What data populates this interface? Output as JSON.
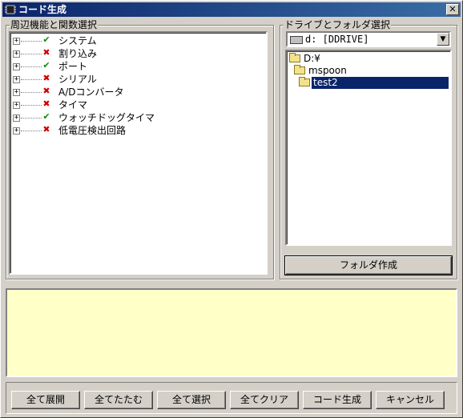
{
  "window": {
    "title": "コード生成",
    "close_glyph": "✕"
  },
  "peripherals": {
    "legend": "周辺機能と関数選択",
    "items": [
      {
        "label": "システム",
        "state": "ok",
        "expander": "+"
      },
      {
        "label": "割り込み",
        "state": "ng",
        "expander": "+"
      },
      {
        "label": "ポート",
        "state": "ok",
        "expander": "+"
      },
      {
        "label": "シリアル",
        "state": "ng",
        "expander": "+"
      },
      {
        "label": "A/Dコンバータ",
        "state": "ng",
        "expander": "+"
      },
      {
        "label": "タイマ",
        "state": "ng",
        "expander": "+"
      },
      {
        "label": "ウォッチドッグタイマ",
        "state": "ok",
        "expander": "+"
      },
      {
        "label": "低電圧検出回路",
        "state": "ng",
        "expander": "+"
      }
    ],
    "state_glyphs": {
      "ok": "✔",
      "ng": "✖"
    }
  },
  "drive_folder": {
    "legend": "ドライブとフォルダ選択",
    "drive": "d: [DDRIVE]",
    "dropdown_glyph": "▼",
    "folders": [
      {
        "label": "D:¥",
        "selected": false
      },
      {
        "label": "mspoon",
        "selected": false
      },
      {
        "label": "test2",
        "selected": true
      }
    ],
    "make_folder_button": "フォルダ作成"
  },
  "message": "",
  "footer_buttons": {
    "expand_all": "全て展開",
    "collapse_all": "全てたたむ",
    "select_all": "全て選択",
    "clear_all": "全てクリア",
    "generate": "コード生成",
    "cancel": "キャンセル"
  },
  "colors": {
    "title_start": "#0a246a",
    "title_end": "#3a6ea5",
    "selection": "#0a246a",
    "message_bg": "#ffffc8"
  }
}
